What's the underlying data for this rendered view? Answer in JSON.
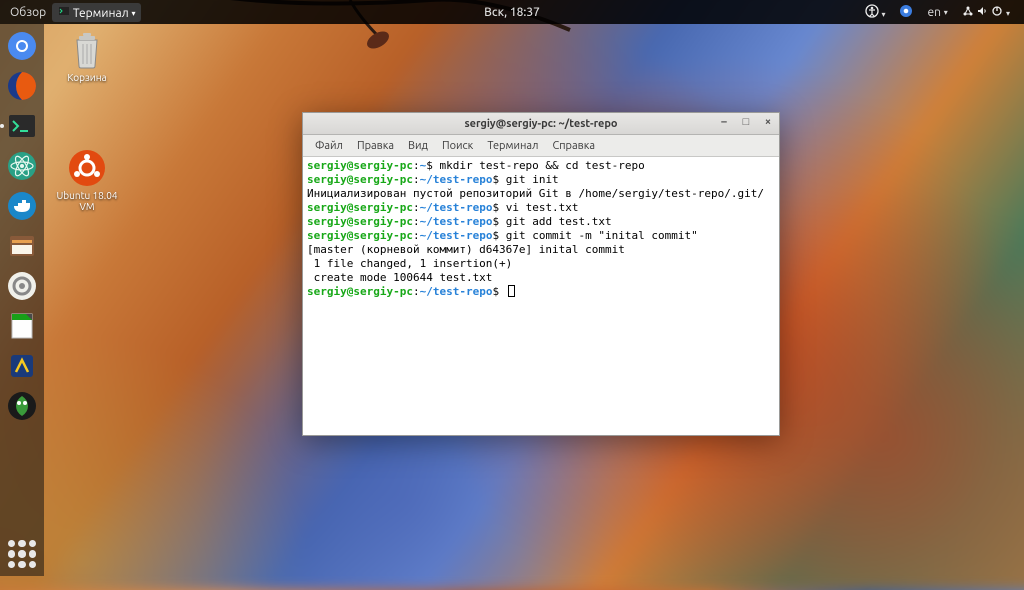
{
  "topbar": {
    "activities": "Обзор",
    "app_indicator": "Терминал",
    "clock": "Вск, 18:37",
    "lang": "en"
  },
  "desktop": {
    "trash_label": "Корзина",
    "ubuntu_label": "Ubuntu 18.04 VM"
  },
  "window": {
    "title": "sergiy@sergiy-pc: ~/test-repo",
    "menu": {
      "file": "Файл",
      "edit": "Правка",
      "view": "Вид",
      "search": "Поиск",
      "terminal": "Терминал",
      "help": "Справка"
    }
  },
  "term": {
    "user": "sergiy@sergiy-pc",
    "home_path": "~",
    "repo_path": "~/test-repo",
    "prompt": "$",
    "cmd1": "mkdir test-repo && cd test-repo",
    "cmd2": "git init",
    "out2": "Инициализирован пустой репозиторий Git в /home/sergiy/test-repo/.git/",
    "cmd3": "vi test.txt",
    "cmd4": "git add test.txt",
    "cmd5": "git commit -m \"inital commit\"",
    "out5a": "[master (корневой коммит) d64367e] inital commit",
    "out5b": " 1 file changed, 1 insertion(+)",
    "out5c": " create mode 100644 test.txt"
  }
}
